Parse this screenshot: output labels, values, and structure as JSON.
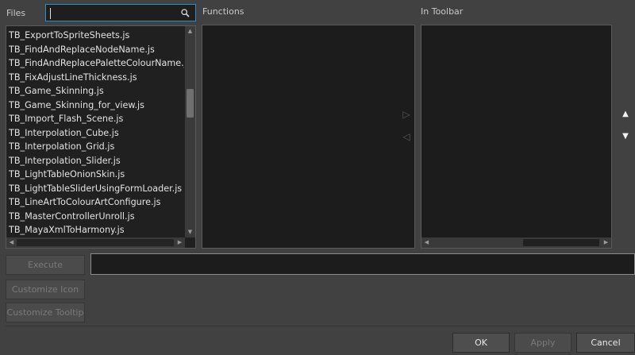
{
  "files": {
    "label": "Files",
    "search_value": "",
    "items": [
      "TB_ExportToSpriteSheets.js",
      "TB_FindAndReplaceNodeName.js",
      "TB_FindAndReplacePaletteColourName.js",
      "TB_FixAdjustLineThickness.js",
      "TB_Game_Skinning.js",
      "TB_Game_Skinning_for_view.js",
      "TB_Import_Flash_Scene.js",
      "TB_Interpolation_Cube.js",
      "TB_Interpolation_Grid.js",
      "TB_Interpolation_Slider.js",
      "TB_LightTableOnionSkin.js",
      "TB_LightTableSliderUsingFormLoader.js",
      "TB_LineArtToColourArtConfigure.js",
      "TB_MasterControllerUnroll.js",
      "TB_MayaXmlToHarmony.js"
    ]
  },
  "functions": {
    "label": "Functions"
  },
  "toolbar": {
    "label": "In Toolbar"
  },
  "actions": {
    "execute": "Execute",
    "customize_icon": "Customize Icon",
    "customize_tooltip": "Customize Tooltip"
  },
  "footer": {
    "ok": "OK",
    "apply": "Apply",
    "cancel": "Cancel"
  },
  "icons": {
    "search": "search-icon",
    "move_right": "triangle-right-icon",
    "move_left": "triangle-left-icon",
    "move_up": "triangle-up-icon",
    "move_down": "triangle-down-icon"
  }
}
